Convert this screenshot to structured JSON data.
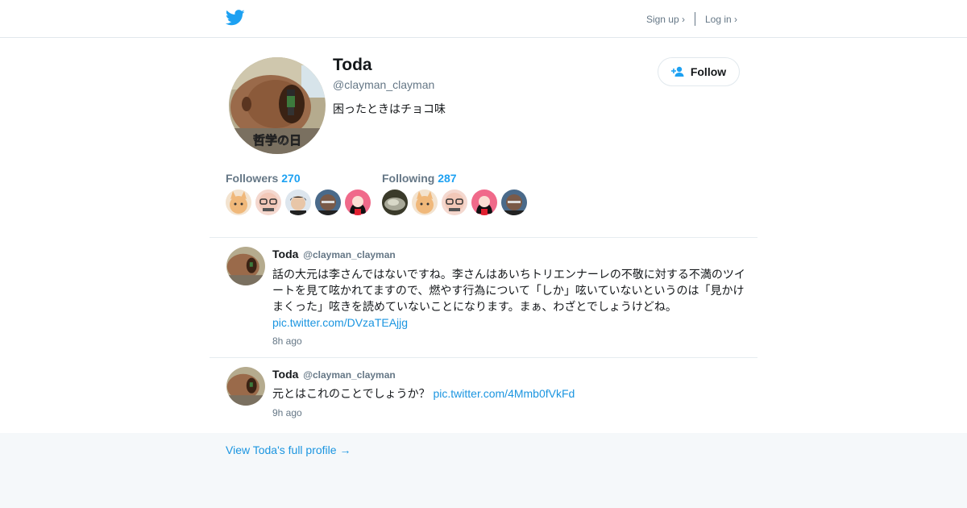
{
  "header": {
    "signup_label": "Sign up ›",
    "login_label": "Log in ›"
  },
  "profile": {
    "name": "Toda",
    "handle": "@clayman_clayman",
    "bio": "困ったときはチョコ味",
    "follow_label": "Follow",
    "avatar_caption": "哲学の日",
    "followers_label": "Followers",
    "followers_count": "270",
    "following_label": "Following",
    "following_count": "287"
  },
  "tweets": [
    {
      "name": "Toda",
      "handle": "@clayman_clayman",
      "text": "話の大元は李さんではないですね。李さんはあいちトリエンナーレの不敬に対する不満のツイートを見て呟かれてますので、燃やす行為について「しか」呟いていないというのは「見かけまくった」呟きを読めていないことになります。まぁ、わざとでしょうけどね。",
      "link": "pic.twitter.com/DVzaTEAjjg",
      "time": "8h ago"
    },
    {
      "name": "Toda",
      "handle": "@clayman_clayman",
      "text": "元とはこれのことでしょうか？",
      "link": "pic.twitter.com/4Mmb0fVkFd",
      "time": "9h ago"
    }
  ],
  "footer": {
    "view_profile_label": "View Toda's full profile →"
  },
  "colors": {
    "brand": "#1da1f2",
    "link": "#1b95e0",
    "muted": "#657786",
    "background": "#f5f8fa"
  }
}
